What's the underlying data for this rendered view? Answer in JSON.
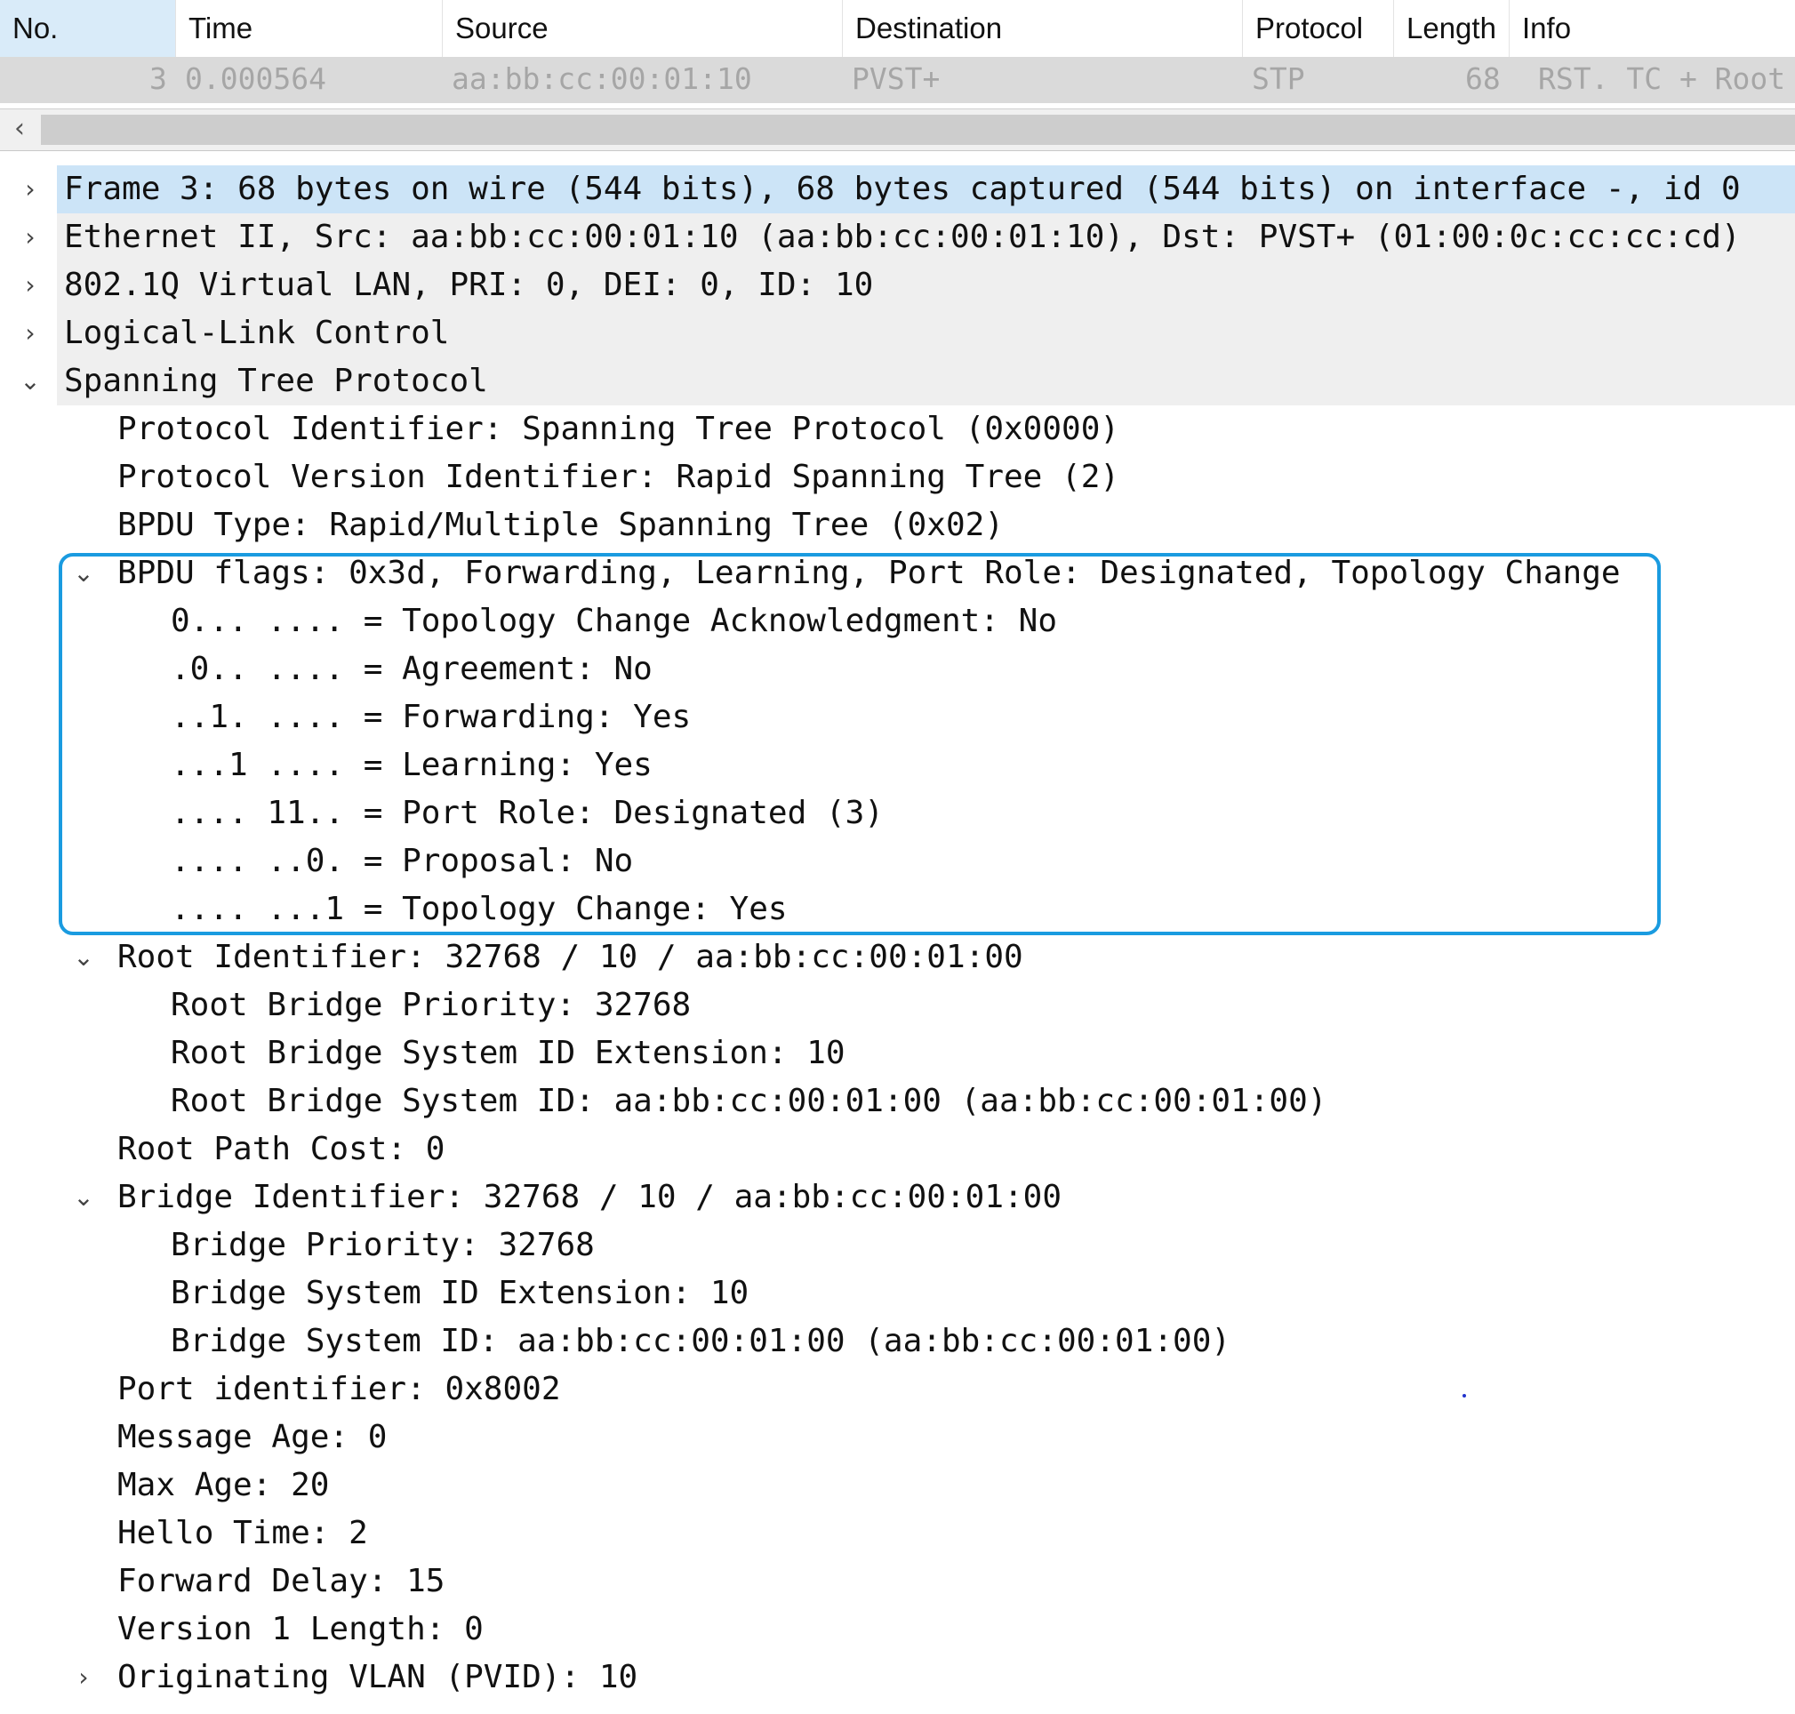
{
  "columns": [
    "No.",
    "Time",
    "Source",
    "Destination",
    "Protocol",
    "Length",
    "Info"
  ],
  "packet": {
    "no": "3",
    "time": "0.000564",
    "source": "aa:bb:cc:00:01:10",
    "destination": "PVST+",
    "protocol": "STP",
    "length": "68",
    "info": "RST. TC + Root"
  },
  "scrollbar": {
    "left_arrow_icon": "chevron-left-icon",
    "glyph": "‹"
  },
  "tree": {
    "frame": "Frame 3: 68 bytes on wire (544 bits), 68 bytes captured (544 bits) on interface -, id 0",
    "ethernet": "Ethernet II, Src: aa:bb:cc:00:01:10 (aa:bb:cc:00:01:10), Dst: PVST+ (01:00:0c:cc:cc:cd)",
    "vlan": "802.1Q Virtual LAN, PRI: 0, DEI: 0, ID: 10",
    "llc": "Logical-Link Control",
    "stp": "Spanning Tree Protocol",
    "protocol_identifier": "Protocol Identifier: Spanning Tree Protocol (0x0000)",
    "protocol_version": "Protocol Version Identifier: Rapid Spanning Tree (2)",
    "bpdu_type": "BPDU Type: Rapid/Multiple Spanning Tree (0x02)",
    "bpdu_flags": "BPDU flags: 0x3d, Forwarding, Learning, Port Role: Designated, Topology Change",
    "flags": [
      "0... .... = Topology Change Acknowledgment: No",
      ".0.. .... = Agreement: No",
      "..1. .... = Forwarding: Yes",
      "...1 .... = Learning: Yes",
      ".... 11.. = Port Role: Designated (3)",
      ".... ..0. = Proposal: No",
      ".... ...1 = Topology Change: Yes"
    ],
    "root_identifier": "Root Identifier: 32768 / 10 / aa:bb:cc:00:01:00",
    "root_children": [
      "Root Bridge Priority: 32768",
      "Root Bridge System ID Extension: 10",
      "Root Bridge System ID: aa:bb:cc:00:01:00 (aa:bb:cc:00:01:00)"
    ],
    "root_path_cost": "Root Path Cost: 0",
    "bridge_identifier": "Bridge Identifier: 32768 / 10 / aa:bb:cc:00:01:00",
    "bridge_children": [
      "Bridge Priority: 32768",
      "Bridge System ID Extension: 10",
      "Bridge System ID: aa:bb:cc:00:01:00 (aa:bb:cc:00:01:00)"
    ],
    "port_identifier": "Port identifier: 0x8002",
    "message_age": "Message Age: 0",
    "max_age": "Max Age: 20",
    "hello_time": "Hello Time: 2",
    "forward_delay": "Forward Delay: 15",
    "version1_length": "Version 1 Length: 0",
    "originating_vlan": "Originating VLAN (PVID): 10"
  },
  "icons": {
    "collapsed": "chevron-right-icon",
    "expanded": "chevron-down-icon",
    "collapsed_glyph": "›",
    "expanded_glyph": "⌄"
  },
  "colors": {
    "selected_row": "#cce4f7",
    "highlight_border": "#1a9be0",
    "packet_row_bg": "#dadada",
    "top_level_bg": "#efefef"
  }
}
